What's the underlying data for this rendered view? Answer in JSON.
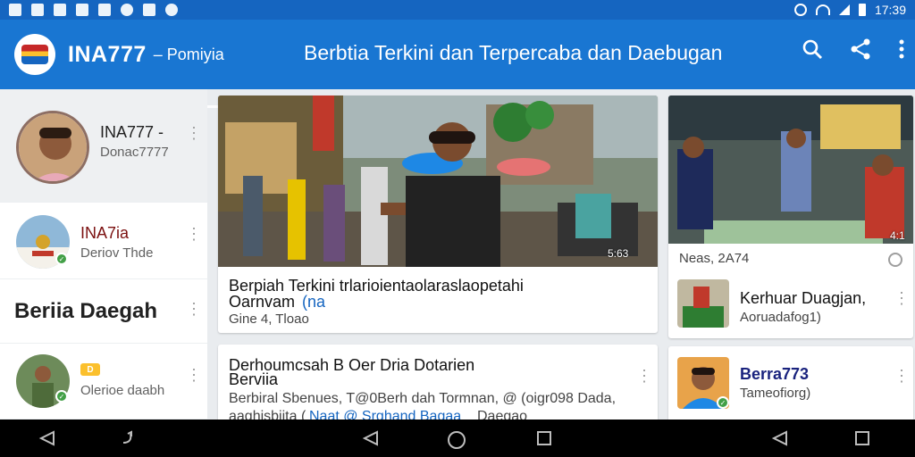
{
  "status_bar": {
    "time": "17:39"
  },
  "app_bar": {
    "title": "INA777",
    "subtitle": "– Pomiyia",
    "headline": "Berbtia Terkini dan Terpercaba dan Daebugan",
    "icons": [
      "search-icon",
      "share-icon",
      "more-vert-icon"
    ]
  },
  "sidebar": {
    "items": [
      {
        "title": "INA777 -",
        "subtitle": "Donac7777"
      },
      {
        "title": "INA7ia",
        "subtitle": "Deriov Thde"
      },
      {
        "title": "Beriia Daegah"
      },
      {
        "badge": "D",
        "subtitle": "Olerioe daabh"
      }
    ]
  },
  "main": {
    "featured": {
      "timer": "5:63",
      "title_line1": "Berpiah Terkini trlarioientaolaraslaopetahi",
      "title_line2_a": "Oarnvam",
      "title_line2_b": "(na",
      "meta": "Gine 4, Tloao"
    },
    "second": {
      "title_line1": "Derhoumcsah B Oer Dria Dotarien",
      "title_line2": "Berviia",
      "excerpt_line1": "Berbiral Sbenues, T@0Berh dah Tormnan, @ (oigr098 Dada,",
      "excerpt_line2_a": "aaghisbiita (",
      "excerpt_line2_b": "Naat @ Srghand Bagaa",
      "excerpt_line2_c": "Daegao"
    }
  },
  "right": {
    "card1": {
      "timer": "4:1",
      "date": "Neas, 2A74"
    },
    "item1": {
      "title": "Kerhuar Duagjan,",
      "subtitle": "Aoruadafog1)"
    },
    "item2": {
      "title": "Berra773",
      "subtitle": "Tameofiorg)"
    }
  },
  "colors": {
    "app_bar": "#1976d2",
    "status_bar": "#1565c0",
    "accent_link": "#1565c0"
  }
}
